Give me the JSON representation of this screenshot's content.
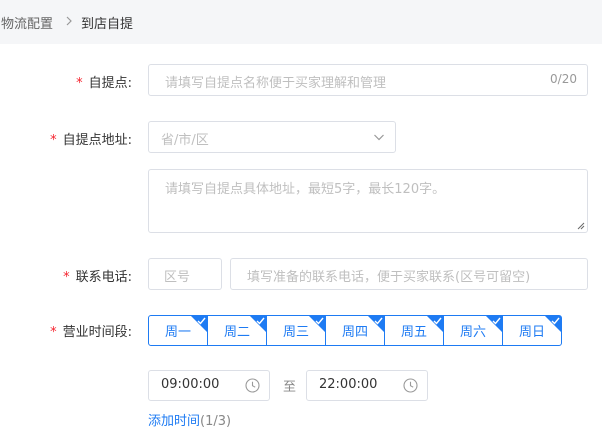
{
  "breadcrumb": {
    "parent": "物流配置",
    "current": "到店自提"
  },
  "form": {
    "pickup_name": {
      "label": "自提点:",
      "placeholder": "请填写自提点名称便于买家理解和管理",
      "counter": "0/20"
    },
    "pickup_address": {
      "label": "自提点地址:",
      "region_placeholder": "省/市/区",
      "detail_placeholder": "请填写自提点具体地址，最短5字，最长120字。"
    },
    "phone": {
      "label": "联系电话:",
      "area_placeholder": "区号",
      "number_placeholder": "填写准备的联系电话，便于买家联系(区号可留空)"
    },
    "hours": {
      "label": "营业时间段:",
      "days": [
        {
          "label": "周一",
          "selected": true
        },
        {
          "label": "周二",
          "selected": true
        },
        {
          "label": "周三",
          "selected": true
        },
        {
          "label": "周四",
          "selected": true
        },
        {
          "label": "周五",
          "selected": true
        },
        {
          "label": "周六",
          "selected": true
        },
        {
          "label": "周日",
          "selected": true
        }
      ],
      "start_time": "09:00:00",
      "to_label": "至",
      "end_time": "22:00:00",
      "add_time_label": "添加时间",
      "add_time_count": "(1/3)"
    }
  },
  "colors": {
    "accent": "#1e7bf3",
    "required": "#f5222d",
    "border": "#dcdfe6",
    "placeholder": "#bfbfbf"
  }
}
